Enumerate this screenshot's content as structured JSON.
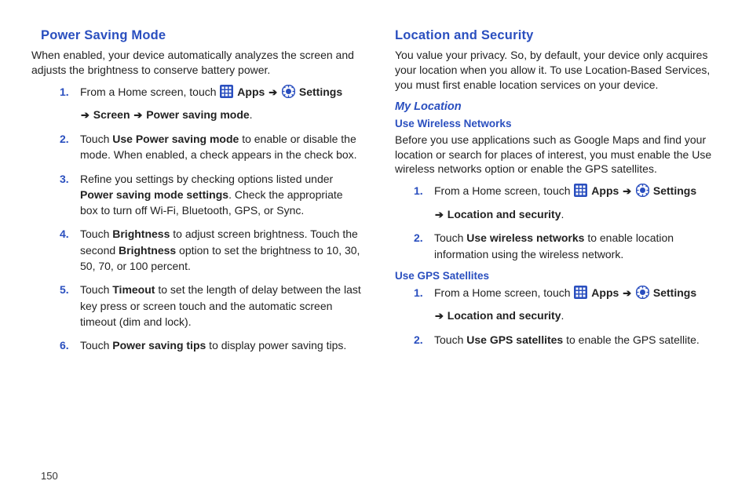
{
  "pageNumber": "150",
  "left": {
    "heading": "Power Saving Mode",
    "intro": "When enabled, your device automatically analyzes the screen and adjusts the brightness to conserve battery power.",
    "step1_pre": "From a Home screen, touch ",
    "apps": "Apps",
    "settings": "Settings",
    "step1_line2a": "Screen",
    "step1_line2b": "Power saving mode",
    "step2_a": "Touch ",
    "step2_b": "Use Power saving mode",
    "step2_c": " to enable or disable the mode. When enabled, a check appears in the check box.",
    "step3_a": "Refine you settings by checking options listed under ",
    "step3_b": "Power saving mode settings",
    "step3_c": ". Check the appropriate box to turn off Wi-Fi, Bluetooth, GPS, or Sync.",
    "step4_a": "Touch ",
    "step4_b": "Brightness",
    "step4_c": " to adjust screen brightness. Touch the second ",
    "step4_d": "Brightness",
    "step4_e": " option to set the brightness to 10, 30, 50, 70, or 100 percent.",
    "step5_a": "Touch ",
    "step5_b": "Timeout",
    "step5_c": " to set the length of delay between the last key press or screen touch and the automatic screen timeout (dim and lock).",
    "step6_a": "Touch ",
    "step6_b": "Power saving tips",
    "step6_c": " to display power saving tips."
  },
  "right": {
    "heading": "Location and Security",
    "intro": "You value your privacy. So, by default, your device only acquires your location when you allow it. To use Location-Based Services, you must first enable location services on your device.",
    "myLocation": "My Location",
    "useWireless": "Use Wireless Networks",
    "wirelessIntro": "Before you use applications such as Google Maps and find your location or search for places of interest, you must enable the Use wireless networks option or enable the GPS satellites.",
    "step1_pre": "From a Home screen, touch ",
    "apps": "Apps",
    "settings": "Settings",
    "locSec": "Location and security",
    "w2_a": "Touch ",
    "w2_b": "Use wireless networks",
    "w2_c": " to enable location information using the wireless network.",
    "useGps": "Use GPS Satellites",
    "g2_a": "Touch ",
    "g2_b": "Use GPS satellites",
    "g2_c": " to enable the GPS satellite."
  }
}
